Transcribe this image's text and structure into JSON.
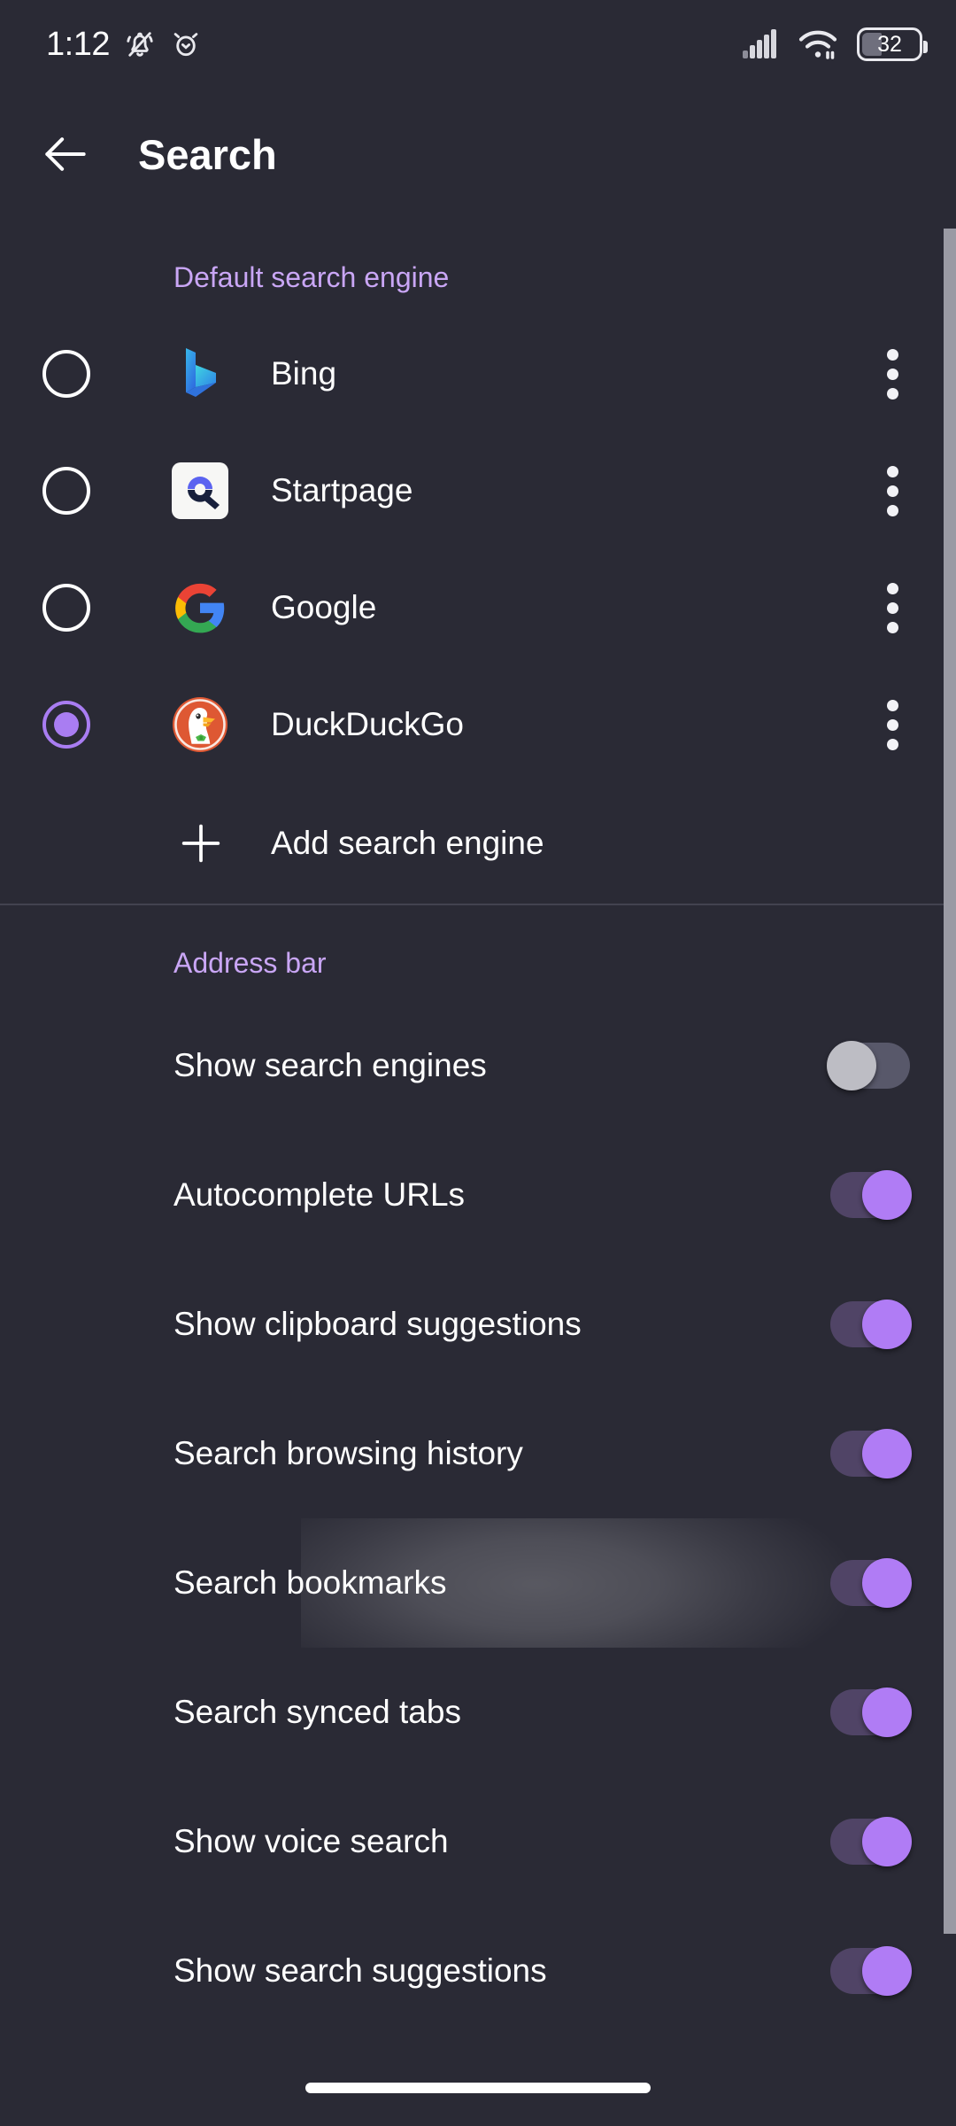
{
  "status_bar": {
    "time": "1:12",
    "icons_left": [
      "notifications-silenced-icon",
      "alarm-icon"
    ],
    "icons_right": [
      "cellular-signal-icon",
      "wifi-icon",
      "battery-icon"
    ],
    "battery_level": "32"
  },
  "app_bar": {
    "back_icon": "back-arrow-icon",
    "title": "Search"
  },
  "colors": {
    "background": "#2a2a35",
    "accent_purple": "#b07cf5",
    "section_header": "#c9a6f5",
    "text_primary": "#ffffff",
    "divider": "#434350",
    "switch_off_thumb": "#bdbdc4",
    "switch_off_track": "#58586a",
    "switch_on_track": "#504466",
    "scrollbar": "#9a9aa4"
  },
  "default_search_engine": {
    "header": "Default search engine",
    "engines": [
      {
        "label": "Bing",
        "selected": false,
        "logo": "bing-logo-icon",
        "menu_icon": "more-options-icon"
      },
      {
        "label": "Startpage",
        "selected": false,
        "logo": "startpage-logo-icon",
        "menu_icon": "more-options-icon"
      },
      {
        "label": "Google",
        "selected": false,
        "logo": "google-logo-icon",
        "menu_icon": "more-options-icon"
      },
      {
        "label": "DuckDuckGo",
        "selected": true,
        "logo": "duckduckgo-logo-icon",
        "menu_icon": "more-options-icon"
      }
    ],
    "add_engine": {
      "label": "Add search engine",
      "icon": "plus-icon"
    }
  },
  "address_bar": {
    "header": "Address bar",
    "settings": [
      {
        "label": "Show search engines",
        "enabled": false,
        "highlighted": false
      },
      {
        "label": "Autocomplete URLs",
        "enabled": true,
        "highlighted": false
      },
      {
        "label": "Show clipboard suggestions",
        "enabled": true,
        "highlighted": false
      },
      {
        "label": "Search browsing history",
        "enabled": true,
        "highlighted": false
      },
      {
        "label": "Search bookmarks",
        "enabled": true,
        "highlighted": true
      },
      {
        "label": "Search synced tabs",
        "enabled": true,
        "highlighted": false
      },
      {
        "label": "Show voice search",
        "enabled": true,
        "highlighted": false
      },
      {
        "label": "Show search suggestions",
        "enabled": true,
        "highlighted": false
      }
    ]
  },
  "navigation": {
    "home_indicator": "home-indicator"
  }
}
